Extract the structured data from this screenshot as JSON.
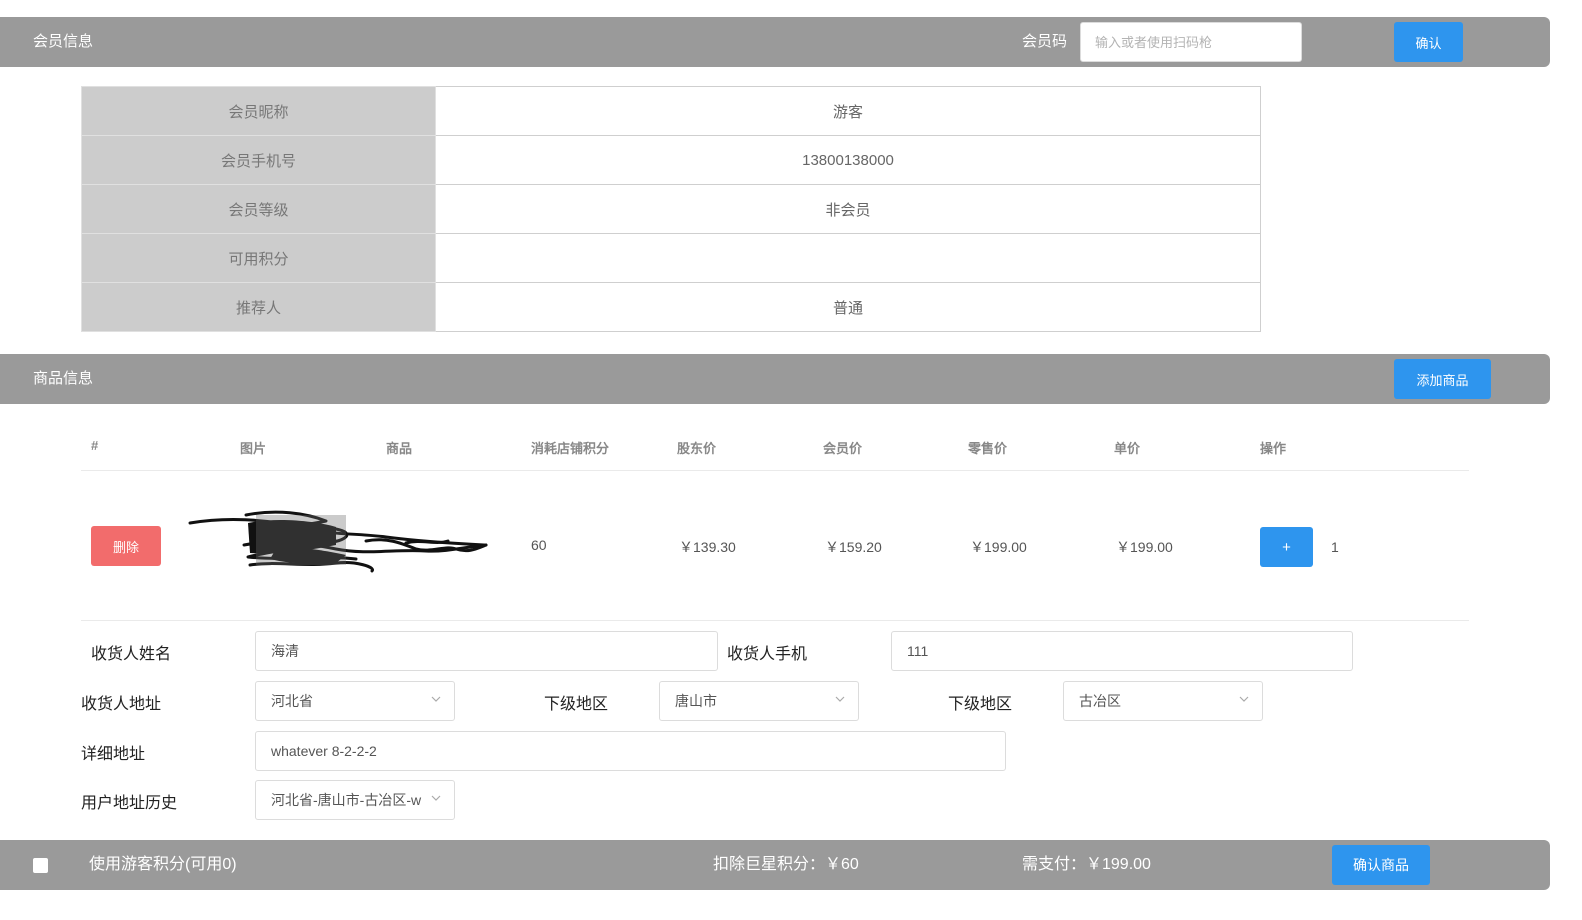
{
  "member_bar": {
    "title": "会员信息",
    "code_label": "会员码",
    "code_placeholder": "输入或者使用扫码枪",
    "confirm_label": "确认"
  },
  "member_table": {
    "rows": [
      {
        "label": "会员昵称",
        "value": "游客"
      },
      {
        "label": "会员手机号",
        "value": "13800138000"
      },
      {
        "label": "会员等级",
        "value": "非会员"
      },
      {
        "label": "可用积分",
        "value": ""
      },
      {
        "label": "推荐人",
        "value": "普通"
      }
    ]
  },
  "goods_bar": {
    "title": "商品信息",
    "add_label": "添加商品"
  },
  "goods_table": {
    "headers": [
      "#",
      "图片",
      "商品",
      "消耗店铺积分",
      "股东价",
      "会员价",
      "零售价",
      "单价",
      "操作"
    ],
    "rows": [
      {
        "delete_label": "删除",
        "points": "60",
        "shareholder_price": "￥139.30",
        "member_price": "￥159.20",
        "retail_price": "￥199.00",
        "unit_price": "￥199.00",
        "plus_label": "+",
        "quantity": "1"
      }
    ]
  },
  "delivery_form": {
    "name_label": "收货人姓名",
    "name_value": "海清",
    "phone_label": "收货人手机",
    "phone_value": "111",
    "address_label": "收货人地址",
    "province_value": "河北省",
    "sub_region_label": "下级地区",
    "city_value": "唐山市",
    "sub_region_label_2": "下级地区",
    "district_value": "古冶区",
    "detail_label": "详细地址",
    "detail_value": "whatever 8-2-2-2",
    "history_label": "用户地址历史",
    "history_value": "河北省-唐山市-古冶区-w"
  },
  "footer": {
    "use_points_label": "使用游客积分(可用0)",
    "deduct_points_text": "扣除巨星积分：￥60",
    "pay_amount_text": "需支付：￥199.00",
    "confirm_goods_label": "确认商品"
  },
  "colors": {
    "bar_bg": "#9a9a9a",
    "primary": "#2e95ee",
    "danger": "#f26c6c",
    "label_cell_bg": "#cccccc"
  }
}
